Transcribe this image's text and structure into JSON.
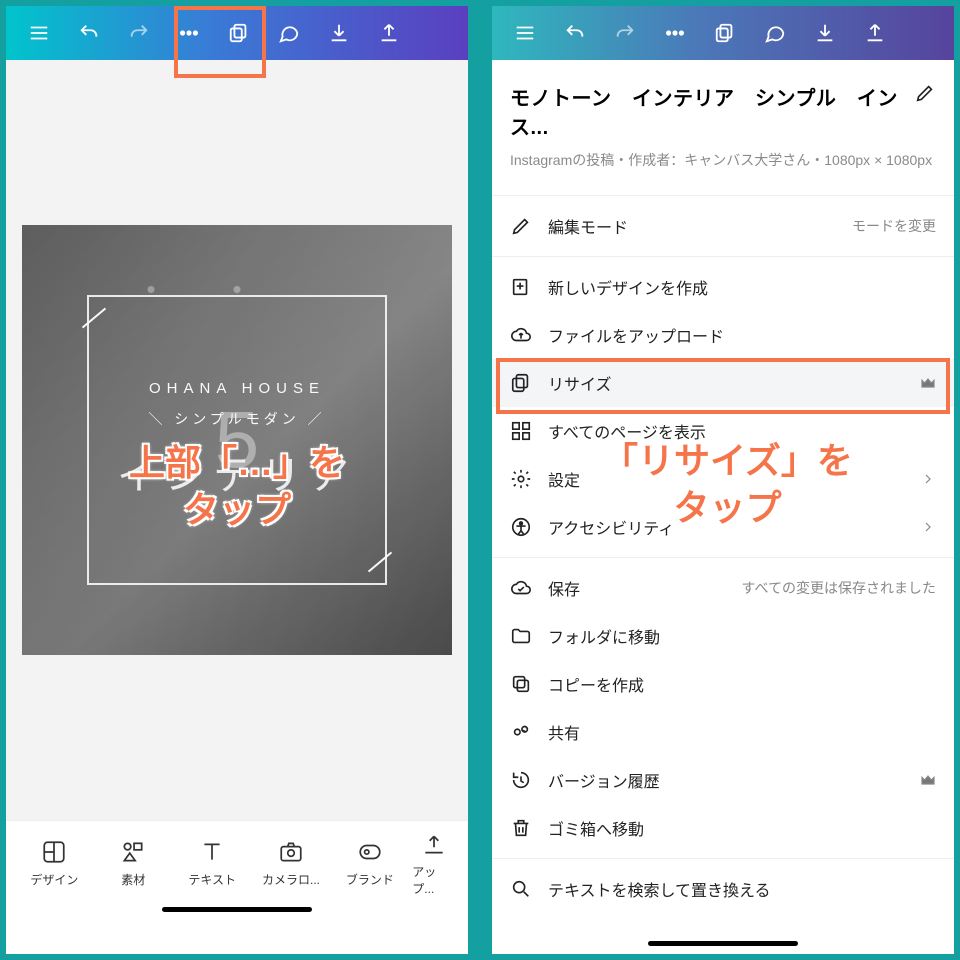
{
  "left": {
    "toolbar_icons": [
      "menu",
      "undo",
      "redo",
      "more",
      "pages",
      "comment",
      "download",
      "export"
    ],
    "design": {
      "brand": "OHANA HOUSE",
      "subtitle": "シンプルモダン",
      "headline": "インテリア",
      "number": "5"
    },
    "annotation": "上部「…」を\nタップ",
    "tabbar": [
      {
        "icon": "layout",
        "label": "デザイン"
      },
      {
        "icon": "shapes",
        "label": "素材"
      },
      {
        "icon": "text",
        "label": "テキスト"
      },
      {
        "icon": "camera",
        "label": "カメラロ..."
      },
      {
        "icon": "brand",
        "label": "ブランド"
      },
      {
        "icon": "upload",
        "label": "アップ..."
      }
    ]
  },
  "right": {
    "title": "モノトーン　インテリア　シンプル　インス...",
    "subtitle": "Instagramの投稿・作成者：キャンバス大学さん・1080px × 1080px",
    "menu": {
      "edit_mode": {
        "label": "編集モード",
        "trail": "モードを変更"
      },
      "new_design": {
        "label": "新しいデザインを作成"
      },
      "upload": {
        "label": "ファイルをアップロード"
      },
      "resize": {
        "label": "リサイズ"
      },
      "all_pages": {
        "label": "すべてのページを表示"
      },
      "settings": {
        "label": "設定"
      },
      "accessibility": {
        "label": "アクセシビリティ"
      },
      "save": {
        "label": "保存",
        "trail": "すべての変更は保存されました"
      },
      "move_folder": {
        "label": "フォルダに移動"
      },
      "copy": {
        "label": "コピーを作成"
      },
      "share": {
        "label": "共有"
      },
      "history": {
        "label": "バージョン履歴"
      },
      "trash": {
        "label": "ゴミ箱へ移動"
      },
      "find_replace": {
        "label": "テキストを検索して置き換える"
      }
    },
    "annotation": "「リサイズ」を\nタップ"
  }
}
